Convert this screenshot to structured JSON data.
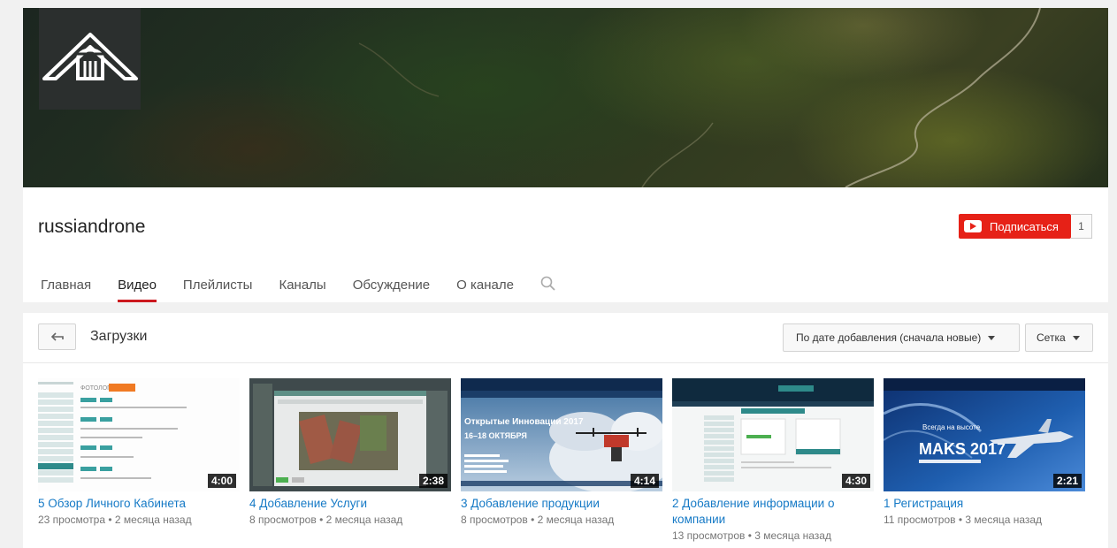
{
  "channel": {
    "name": "russiandrone",
    "subscribe_label": "Подписаться",
    "subscriber_count": "1"
  },
  "tabs": [
    "Главная",
    "Видео",
    "Плейлисты",
    "Каналы",
    "Обсуждение",
    "О канале"
  ],
  "active_tab": "Видео",
  "section": {
    "title": "Загрузки",
    "sort_label": "По дате добавления (сначала новые)",
    "view_label": "Сетка"
  },
  "videos": [
    {
      "title": "5 Обзор Личного Кабинета",
      "duration": "4:00",
      "views": "23 просмотра",
      "age": "2 месяца назад"
    },
    {
      "title": "4 Добавление Услуги",
      "duration": "2:38",
      "views": "8 просмотров",
      "age": "2 месяца назад"
    },
    {
      "title": "3 Добавление продукции",
      "duration": "4:14",
      "views": "8 просмотров",
      "age": "2 месяца назад"
    },
    {
      "title": "2 Добавление информации о компании",
      "duration": "4:30",
      "views": "13 просмотров",
      "age": "3 месяца назад"
    },
    {
      "title": "1 Регистрация",
      "duration": "2:21",
      "views": "11 просмотров",
      "age": "3 месяца назад"
    }
  ],
  "meta_separator": "•",
  "thumb_text": {
    "t1_heading": "ФОТОЛОГОС",
    "t3_headline": "Открытые Инновации 2017",
    "t3_dates": "16–18 ОКТЯБРЯ",
    "t5_slogan": "Всегда на высоте",
    "t5_brand": "MAKS 2017"
  },
  "colors": {
    "subscribe": "#e62117",
    "link": "#167ac6",
    "active_tab": "#cc181e"
  }
}
